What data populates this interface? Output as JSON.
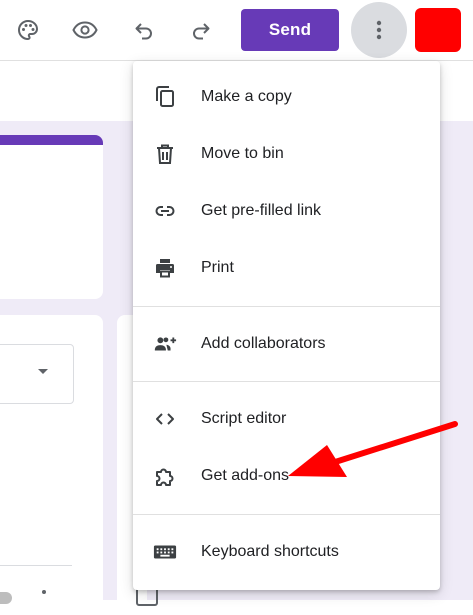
{
  "toolbar": {
    "icons": [
      "palette-icon",
      "eye-icon",
      "undo-icon",
      "redo-icon"
    ],
    "send_label": "Send",
    "more_icon": "more-vert-icon",
    "avatar_color": "#ff0000",
    "accent_color": "#673ab7"
  },
  "menu": {
    "items": [
      {
        "label": "Make a copy",
        "icon": "copy-icon"
      },
      {
        "label": "Move to bin",
        "icon": "trash-icon"
      },
      {
        "label": "Get pre-filled link",
        "icon": "link-icon"
      },
      {
        "label": "Print",
        "icon": "printer-icon"
      },
      {
        "label": "Add collaborators",
        "icon": "add-people-icon"
      },
      {
        "label": "Script editor",
        "icon": "code-icon"
      },
      {
        "label": "Get add-ons",
        "icon": "puzzle-icon"
      },
      {
        "label": "Keyboard shortcuts",
        "icon": "keyboard-icon"
      }
    ]
  },
  "annotation": {
    "type": "arrow",
    "color": "#ff0000",
    "points_to": "Get add-ons"
  },
  "background_color": "#efebf7"
}
